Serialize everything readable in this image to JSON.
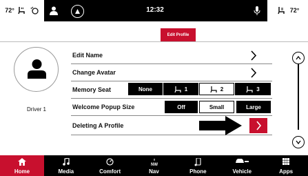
{
  "status_bar": {
    "temp_left": "72°",
    "temp_right": "72°",
    "clock": "12:32",
    "icons": [
      "heated-seat-icon",
      "heated-steering-icon",
      "person-icon",
      "alexa-icon",
      "microphone-icon",
      "seat-fan-icon"
    ]
  },
  "title": "Edit Profile",
  "profile": {
    "driver_label": "Driver 1",
    "avatar_icon": "person-icon"
  },
  "rows": {
    "edit_name": {
      "label": "Edit Name"
    },
    "change_avatar": {
      "label": "Change Avatar"
    },
    "memory_seat": {
      "label": "Memory Seat",
      "options": [
        "None",
        "1",
        "2",
        "3"
      ],
      "selected": "2"
    },
    "welcome_popup": {
      "label": "Welcome Popup Size",
      "options": [
        "Off",
        "Small",
        "Large"
      ],
      "selected": "Small"
    },
    "deleting_profile": {
      "label": "Deleting A Profile"
    }
  },
  "nav": {
    "items": [
      {
        "label": "Home",
        "icon": "home-icon",
        "active": true
      },
      {
        "label": "Media",
        "icon": "music-note-icon",
        "active": false
      },
      {
        "label": "Comfort",
        "icon": "comfort-icon",
        "active": false
      },
      {
        "label": "Nav",
        "icon": "compass-icon",
        "active": false
      },
      {
        "label": "Phone",
        "icon": "phone-icon",
        "active": false
      },
      {
        "label": "Vehicle",
        "icon": "car-icon",
        "active": false
      },
      {
        "label": "Apps",
        "icon": "apps-grid-icon",
        "active": false
      }
    ]
  },
  "colors": {
    "accent": "#c8102e",
    "background": "#ffffff",
    "bar": "#000000"
  }
}
